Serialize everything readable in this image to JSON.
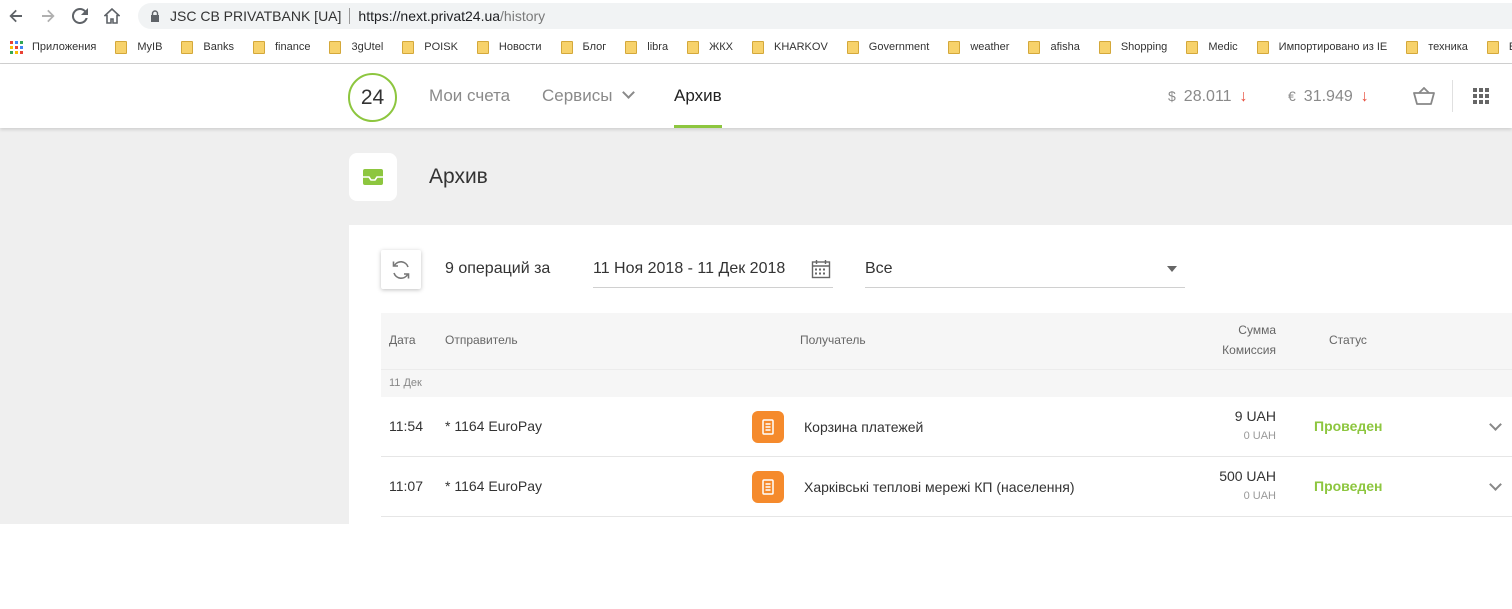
{
  "browser": {
    "site_name": "JSC CB PRIVATBANK [UA]",
    "url_host": "https://next.privat24.ua",
    "url_path": "/history",
    "bookmarks": [
      {
        "label": "Приложения",
        "icon": "apps-icon"
      },
      {
        "label": "MyIB",
        "icon": "folder-icon"
      },
      {
        "label": "Banks",
        "icon": "folder-icon"
      },
      {
        "label": "finance",
        "icon": "folder-icon"
      },
      {
        "label": "3gUtel",
        "icon": "folder-icon"
      },
      {
        "label": "POISK",
        "icon": "folder-icon"
      },
      {
        "label": "Новости",
        "icon": "folder-icon"
      },
      {
        "label": "Блог",
        "icon": "folder-icon"
      },
      {
        "label": "libra",
        "icon": "folder-icon"
      },
      {
        "label": "ЖКХ",
        "icon": "folder-icon"
      },
      {
        "label": "KHARKOV",
        "icon": "folder-icon"
      },
      {
        "label": "Government",
        "icon": "folder-icon"
      },
      {
        "label": "weather",
        "icon": "folder-icon"
      },
      {
        "label": "afisha",
        "icon": "folder-icon"
      },
      {
        "label": "Shopping",
        "icon": "folder-icon"
      },
      {
        "label": "Medic",
        "icon": "folder-icon"
      },
      {
        "label": "Импортировано из IE",
        "icon": "folder-icon"
      },
      {
        "label": "техника",
        "icon": "folder-icon"
      },
      {
        "label": "ENGLI",
        "icon": "folder-icon"
      }
    ]
  },
  "header": {
    "logo_text": "24",
    "nav": {
      "accounts": "Мои счета",
      "services": "Сервисы",
      "archive": "Архив"
    },
    "rates": {
      "usd_symbol": "$",
      "usd_value": "28.011",
      "usd_arrow": "↓",
      "eur_symbol": "€",
      "eur_value": "31.949",
      "eur_arrow": "↓"
    },
    "accent_color": "#8dc63f",
    "down_arrow_color": "#e74c3c"
  },
  "page": {
    "title": "Архив",
    "ops_count": "9 операций за",
    "date_range": "11 Ноя 2018 - 11 Дек 2018",
    "filter_value": "Все"
  },
  "table": {
    "headers": {
      "date": "Дата",
      "sender": "Отправитель",
      "recipient": "Получатель",
      "amount": "Сумма",
      "fee": "Комиссия",
      "status": "Статус"
    },
    "group_label": "11 Дек",
    "rows": [
      {
        "time": "11:54",
        "sender": "* 1164 EuroPay",
        "recipient": "Корзина платежей",
        "amount": "9 UAH",
        "fee": "0 UAH",
        "status": "Проведен"
      },
      {
        "time": "11:07",
        "sender": "* 1164 EuroPay",
        "recipient": "Харківські теплові мережі КП (населення)",
        "amount": "500 UAH",
        "fee": "0 UAH",
        "status": "Проведен"
      }
    ]
  }
}
